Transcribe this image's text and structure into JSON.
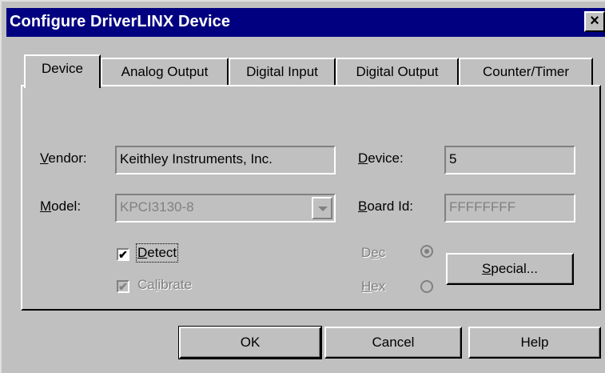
{
  "window": {
    "title": "Configure DriverLINX Device",
    "close_label": "×"
  },
  "tabs": [
    {
      "label": "Device",
      "active": true
    },
    {
      "label": "Analog Output",
      "active": false
    },
    {
      "label": "Digital Input",
      "active": false
    },
    {
      "label": "Digital Output",
      "active": false
    },
    {
      "label": "Counter/Timer",
      "active": false
    }
  ],
  "device_tab": {
    "vendor": {
      "label_mnemonic": "V",
      "label_rest": "endor:",
      "value": "Keithley Instruments, Inc."
    },
    "device": {
      "label_mnemonic": "D",
      "label_rest": "evice:",
      "value": "5"
    },
    "model": {
      "label_mnemonic": "M",
      "label_rest": "odel:",
      "value": "KPCI3130-8",
      "enabled": false
    },
    "board_id": {
      "label_mnemonic": "B",
      "label_rest": "oard Id:",
      "value": "FFFFFFFF",
      "enabled": false
    },
    "detect": {
      "label_mnemonic": "D",
      "label_rest": "etect",
      "checked": true,
      "mark": "✔"
    },
    "calibrate": {
      "label_pre": "Ca",
      "label_mnemonic": "l",
      "label_rest": "ibrate",
      "checked": true,
      "enabled": false,
      "mark": "✔"
    },
    "radix": {
      "dec": {
        "label_pre": "D",
        "label_mnemonic": "e",
        "label_rest": "c",
        "selected": true,
        "enabled": false
      },
      "hex": {
        "label_mnemonic": "H",
        "label_rest": "ex",
        "selected": false,
        "enabled": false
      }
    },
    "special_button": {
      "label_mnemonic": "S",
      "label_rest": "pecial..."
    }
  },
  "footer": {
    "ok_label": "OK",
    "cancel_label": "Cancel",
    "help_label": "Help"
  },
  "colors": {
    "titlebar": "#000080",
    "face": "#c0c0c0",
    "disabled_text": "#808080"
  }
}
